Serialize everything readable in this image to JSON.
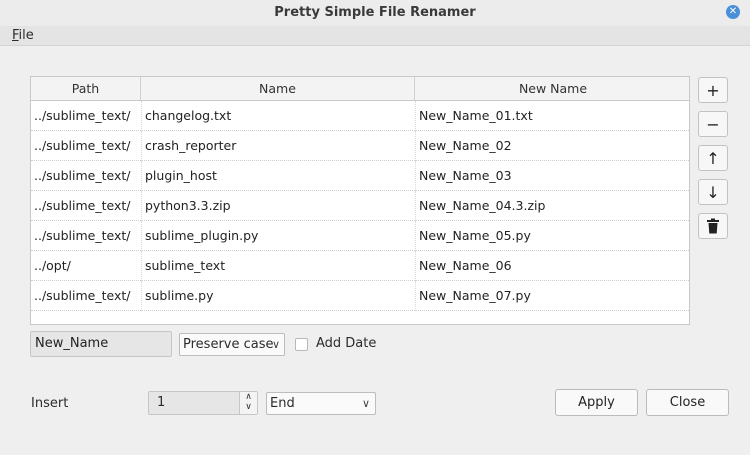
{
  "window": {
    "title": "Pretty Simple File Renamer"
  },
  "menu": {
    "file_accel": "F",
    "file_rest": "ile"
  },
  "table": {
    "headers": [
      "Path",
      "Name",
      "New Name"
    ],
    "rows": [
      [
        "../sublime_text/",
        "changelog.txt",
        "New_Name_01.txt"
      ],
      [
        "../sublime_text/",
        "crash_reporter",
        "New_Name_02"
      ],
      [
        "../sublime_text/",
        "plugin_host",
        "New_Name_03"
      ],
      [
        "../sublime_text/",
        "python3.3.zip",
        "New_Name_04.3.zip"
      ],
      [
        "../sublime_text/",
        "sublime_plugin.py",
        "New_Name_05.py"
      ],
      [
        "../opt/",
        "sublime_text",
        "New_Name_06"
      ],
      [
        "../sublime_text/",
        "sublime.py",
        "New_Name_07.py"
      ]
    ]
  },
  "side_buttons": {
    "add": "+",
    "remove": "−",
    "up": "↑",
    "down": "↓"
  },
  "options": {
    "name_value": "New_Name",
    "case_selected": "Preserve case",
    "add_date_label": "Add Date",
    "add_date_checked": false
  },
  "insert": {
    "label": "Insert",
    "value": "1",
    "position_selected": "End"
  },
  "buttons": {
    "apply": "Apply",
    "close": "Close"
  },
  "colors": {
    "close_icon": "#4a90d9"
  }
}
